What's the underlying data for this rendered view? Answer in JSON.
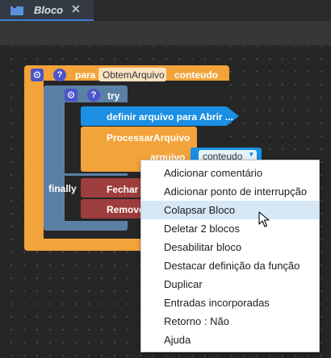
{
  "tab": {
    "title": "Bloco",
    "close": "✕",
    "icon": "blocks-icon"
  },
  "colors": {
    "procedure": "#f2a33a",
    "try": "#5b80a5",
    "call": "#1a8fe3",
    "variable": "#f2a33a",
    "finally": "#9e3d3d",
    "dropdown": "#1a8fe3"
  },
  "procedure": {
    "keyword": "para",
    "name": "ObtemArquivo",
    "param": "conteudo"
  },
  "try_block": {
    "label": "try",
    "finally_label": "finally"
  },
  "blocks": {
    "set_file": "definir arquivo para Abrir ...",
    "process": "ProcessarArquivo",
    "arg_label": "arquivo",
    "arg_value": "conteudo",
    "close": "Fechar o",
    "remove": "Remove"
  },
  "context_menu": {
    "highlighted_index": 2,
    "items": [
      "Adicionar comentário",
      "Adicionar ponto de interrupção",
      "Colapsar Bloco",
      "Deletar 2 blocos",
      "Desabilitar bloco",
      "Destacar definição da função",
      "Duplicar",
      "Entradas incorporadas",
      "Retorno : Não",
      "Ajuda"
    ]
  }
}
